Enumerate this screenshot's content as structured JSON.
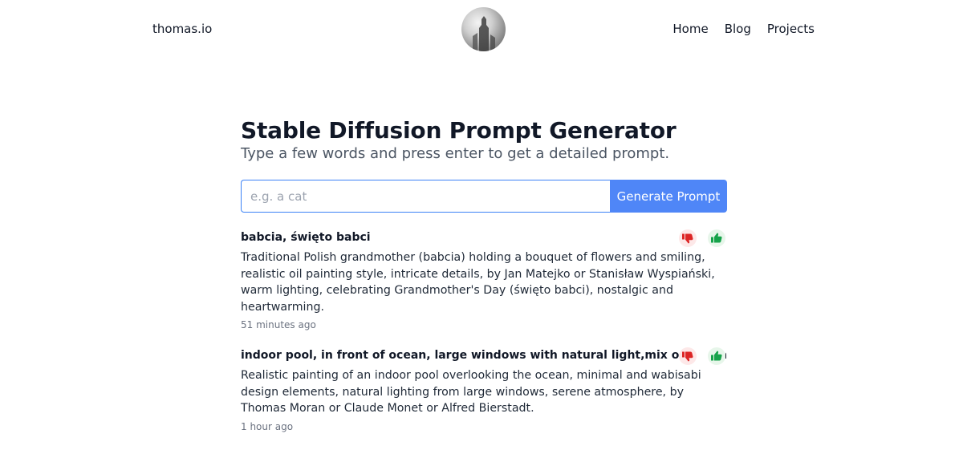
{
  "header": {
    "brand": "thomas.io",
    "nav": [
      "Home",
      "Blog",
      "Projects"
    ]
  },
  "main": {
    "title": "Stable Diffusion Prompt Generator",
    "subtitle": "Type a few words and press enter to get a detailed prompt.",
    "search": {
      "placeholder": "e.g. a cat",
      "value": "",
      "button_label": "Generate Prompt"
    }
  },
  "prompts": [
    {
      "title": "babcia, święto babci",
      "text": "Traditional Polish grandmother (babcia) holding a bouquet of flowers and smiling, realistic oil painting style, intricate details, by Jan Matejko or Stanisław Wyspiański, warm lighting, celebrating Grandmother's Day (święto babci), nostalgic and heartwarming.",
      "time": "51 minutes ago"
    },
    {
      "title": "indoor pool, in front of ocean, large windows with natural light,mix of minimal and wabis",
      "text": "Realistic painting of an indoor pool overlooking the ocean, minimal and wabisabi design elements, natural lighting from large windows, serene atmosphere, by Thomas Moran or Claude Monet or Alfred Bierstadt.",
      "time": "1 hour ago"
    }
  ],
  "icons": {
    "dislike": "thumbs-down-icon",
    "like": "thumbs-up-icon"
  },
  "colors": {
    "accent": "#4f86f7",
    "input_border": "#3b82f6",
    "dislike": "#dc2626",
    "like": "#16a34a"
  }
}
